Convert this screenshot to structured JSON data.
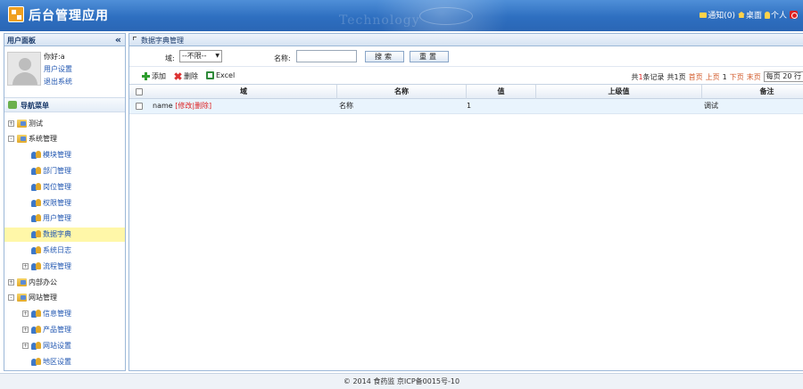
{
  "header": {
    "app_title": "后台管理应用",
    "watermark": "Technology",
    "links": [
      {
        "label": "通知(0)",
        "icon": "message-icon"
      },
      {
        "label": "桌面",
        "icon": "home-icon"
      },
      {
        "label": "个人",
        "icon": "user-icon"
      }
    ]
  },
  "sidebar": {
    "panel_title": "用户面板",
    "collapse_glyph": "«",
    "user": {
      "greeting": "你好:a",
      "settings_link": "用户设置",
      "logout_link": "退出系统"
    },
    "nav_title": "导航菜单",
    "tree": [
      {
        "label": "测试",
        "level": 0,
        "toggle": "+",
        "icon": "folder-icon"
      },
      {
        "label": "系统管理",
        "level": 0,
        "toggle": "-",
        "icon": "folder-icon"
      },
      {
        "label": "模块管理",
        "level": 1,
        "icon": "people-icon"
      },
      {
        "label": "部门管理",
        "level": 1,
        "icon": "people-icon"
      },
      {
        "label": "岗位管理",
        "level": 1,
        "icon": "people-icon"
      },
      {
        "label": "权限管理",
        "level": 1,
        "icon": "people-icon"
      },
      {
        "label": "用户管理",
        "level": 1,
        "icon": "people-icon"
      },
      {
        "label": "数据字典",
        "level": 1,
        "icon": "people-icon",
        "active": true
      },
      {
        "label": "系统日志",
        "level": 1,
        "icon": "people-icon"
      },
      {
        "label": "流程管理",
        "level": 1,
        "toggle": "+",
        "icon": "people-icon"
      },
      {
        "label": "内部办公",
        "level": 0,
        "toggle": "+",
        "icon": "folder-icon"
      },
      {
        "label": "网站管理",
        "level": 0,
        "toggle": "-",
        "icon": "folder-icon"
      },
      {
        "label": "信息管理",
        "level": 1,
        "toggle": "+",
        "icon": "people-icon"
      },
      {
        "label": "产品管理",
        "level": 1,
        "toggle": "+",
        "icon": "people-icon"
      },
      {
        "label": "网站设置",
        "level": 1,
        "toggle": "+",
        "icon": "people-icon"
      },
      {
        "label": "地区设置",
        "level": 1,
        "icon": "people-icon"
      }
    ]
  },
  "main": {
    "panel_title": "数据字典管理",
    "search": {
      "domain_label": "域:",
      "domain_value": "--不限--",
      "name_label": "名称:",
      "name_value": "",
      "search_button": "搜索",
      "reset_button": "重置"
    },
    "toolbar": {
      "add": "添加",
      "delete": "删除",
      "excel": "Excel"
    },
    "pager": {
      "total_prefix": "共",
      "total_count": "1",
      "total_suffix": "条记录",
      "pages_text": "共1页",
      "first": "首页",
      "prev": "上页",
      "current": "1",
      "next": "下页",
      "last": "末页",
      "page_size": "每页 20 行"
    },
    "columns": [
      "域",
      "名称",
      "值",
      "上级值",
      "备注"
    ],
    "rows": [
      {
        "domain": "name",
        "edit": "[修改",
        "remove": "|删除]",
        "name": "名称",
        "value": "1",
        "parent": "",
        "remark": "调试"
      }
    ]
  },
  "footer": {
    "text": "© 2014 食药监 京ICP备0015号-10"
  }
}
